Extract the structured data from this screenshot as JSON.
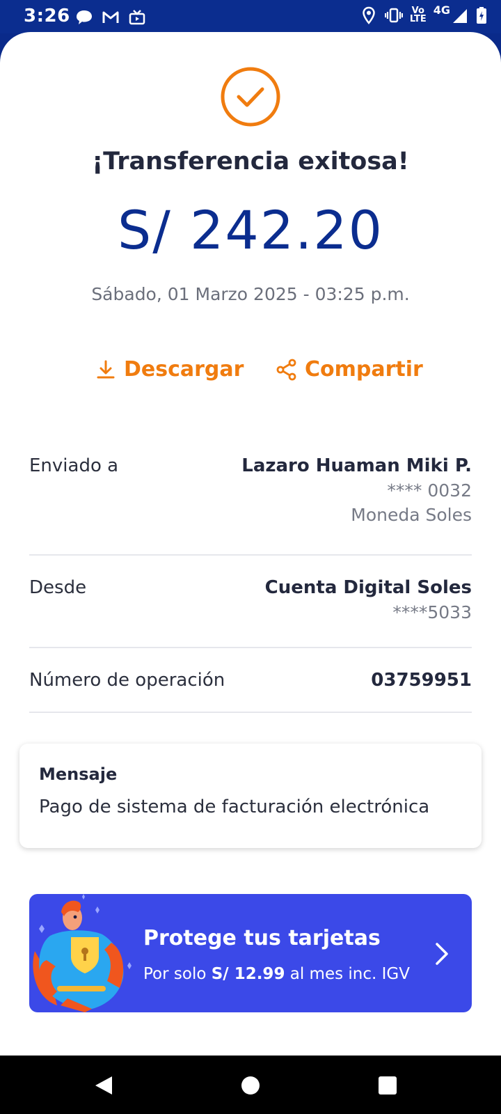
{
  "status_bar": {
    "time": "3:26",
    "volte_top": "Vo",
    "volte_bottom": "LTE",
    "network": "4G"
  },
  "receipt": {
    "title": "¡Transferencia exitosa!",
    "amount": "S/ 242.20",
    "datetime": "Sábado, 01 Marzo 2025 - 03:25 p.m.",
    "download_label": "Descargar",
    "share_label": "Compartir"
  },
  "details": {
    "sent_to_label": "Enviado a",
    "recipient_name": "Lazaro Huaman Miki P.",
    "recipient_account": "**** 0032",
    "recipient_currency": "Moneda Soles",
    "from_label": "Desde",
    "from_account_name": "Cuenta Digital Soles",
    "from_account_number": "****5033",
    "operation_label": "Número de operación",
    "operation_number": "03759951"
  },
  "message": {
    "title": "Mensaje",
    "body": "Pago de sistema de facturación electrónica"
  },
  "promo": {
    "title": "Protege tus tarjetas",
    "sub_prefix": "Por solo",
    "sub_price": "S/ 12.99",
    "sub_suffix": "al mes inc. IGV"
  },
  "colors": {
    "accent": "#f07c0f",
    "brand_blue": "#0b2d8f",
    "promo_bg": "#3b49e8"
  },
  "icons": [
    "chat-icon",
    "gmail-icon",
    "tv-icon",
    "location-icon",
    "vibrate-icon",
    "signal-icon",
    "battery-icon",
    "check-circle-icon",
    "download-icon",
    "share-icon",
    "chevron-right-icon",
    "back-icon",
    "home-icon",
    "recents-icon"
  ]
}
